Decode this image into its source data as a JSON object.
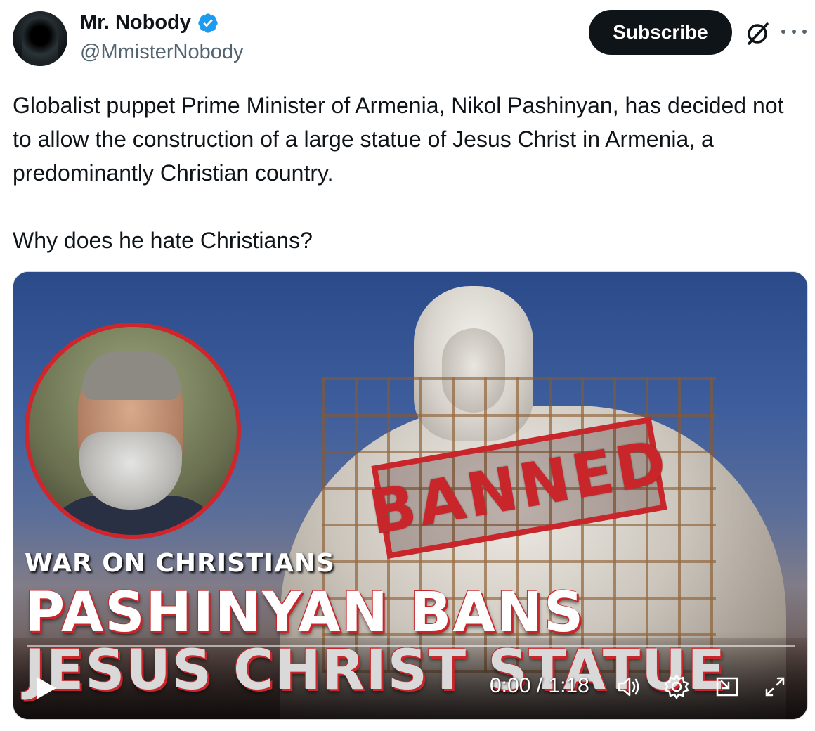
{
  "author": {
    "name": "Mr. Nobody",
    "handle": "@MmisterNobody",
    "verified": true,
    "avatar_icon": "hooded-figure-avatar"
  },
  "header": {
    "subscribe_label": "Subscribe",
    "grok_icon": "grok-icon",
    "more_icon": "more-icon"
  },
  "tweet": {
    "paragraph_1": "Globalist puppet Prime Minister of Armenia, Nikol Pashinyan, has decided not to allow the construction of a large statue of Jesus Christ in Armenia, a predominantly Christian country.",
    "paragraph_2": "Why does he hate Christians?"
  },
  "video": {
    "stamp_text": "BANNED",
    "caption_small": "WAR ON CHRISTIANS",
    "caption_line_1": "PASHINYAN BANS",
    "caption_line_2": "JESUS CHRIST STATUE",
    "current_time": "0:00",
    "duration": "1:18",
    "time_display": "0:00 / 1:18",
    "progress": 0,
    "accent_color": "#c8262a"
  },
  "colors": {
    "verified_blue": "#1d9bf0",
    "subscribe_bg": "#0f1419",
    "secondary_text": "#536471"
  }
}
